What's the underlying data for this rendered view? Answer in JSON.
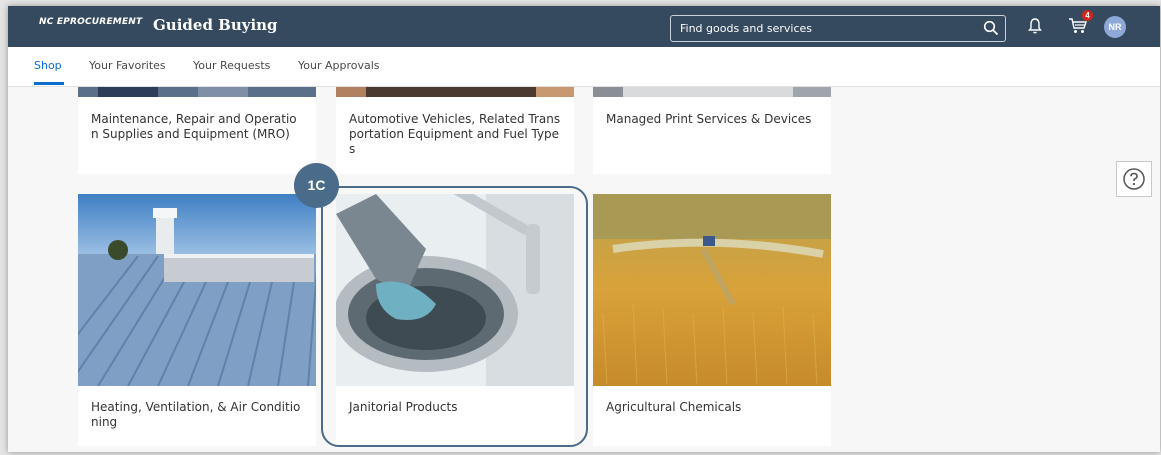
{
  "header": {
    "brand": "NC eProcurement",
    "title": "Guided Buying",
    "search_placeholder": "Find goods and services",
    "cart_count": "4",
    "avatar_initials": "NR"
  },
  "tabs": [
    {
      "label": "Shop",
      "active": true
    },
    {
      "label": "Your Favorites",
      "active": false
    },
    {
      "label": "Your Requests",
      "active": false
    },
    {
      "label": "Your Approvals",
      "active": false
    }
  ],
  "tiles": [
    {
      "label": "Maintenance, Repair and Operation Supplies and Equipment (MRO)"
    },
    {
      "label": "Automotive Vehicles, Related Transportation Equipment and Fuel Types"
    },
    {
      "label": "Managed Print Services & Devices"
    },
    {
      "label": "Heating, Ventilation, & Air Conditioning"
    },
    {
      "label": "Janitorial Products"
    },
    {
      "label": "Agricultural Chemicals"
    }
  ],
  "annotation": {
    "step": "1C"
  },
  "colors": {
    "header_bg": "#354a5f",
    "accent": "#0a6ed1",
    "badge": "#d0261c",
    "callout": "#4a6b8a"
  }
}
